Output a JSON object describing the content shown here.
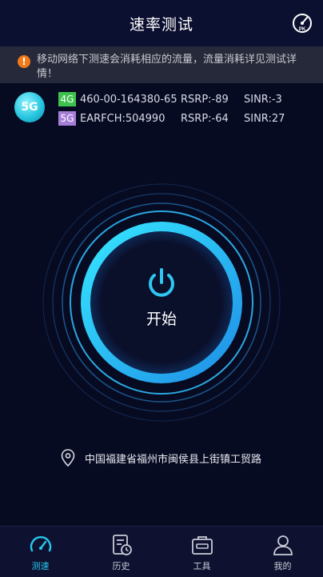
{
  "header": {
    "title": "速率测试",
    "pk_badge": "PK"
  },
  "notice": {
    "text": "移动网络下测速会消耗相应的流量，流量消耗详见测试详情！",
    "icon_glyph": "!"
  },
  "network": {
    "logo_text": "5G",
    "rows": [
      {
        "badge": "4G",
        "value": "460-00-164380-65",
        "rsrp": "RSRP:-89",
        "sinr": "SINR:-3"
      },
      {
        "badge": "5G",
        "value": "EARFCH:504990",
        "rsrp": "RSRP:-64",
        "sinr": "SINR:27"
      }
    ]
  },
  "start": {
    "label": "开始"
  },
  "location": {
    "text": "中国福建省福州市闽侯县上街镇工贸路"
  },
  "tabs": [
    {
      "label": "测速",
      "icon": "speedometer-icon",
      "active": true
    },
    {
      "label": "历史",
      "icon": "history-icon",
      "active": false
    },
    {
      "label": "工具",
      "icon": "toolbox-icon",
      "active": false
    },
    {
      "label": "我的",
      "icon": "user-icon",
      "active": false
    }
  ],
  "colors": {
    "accent": "#27c9f0",
    "background": "#070b22",
    "warning": "#f07a1a",
    "badge_4g": "#3ec24e",
    "badge_5g": "#a57ed8"
  }
}
